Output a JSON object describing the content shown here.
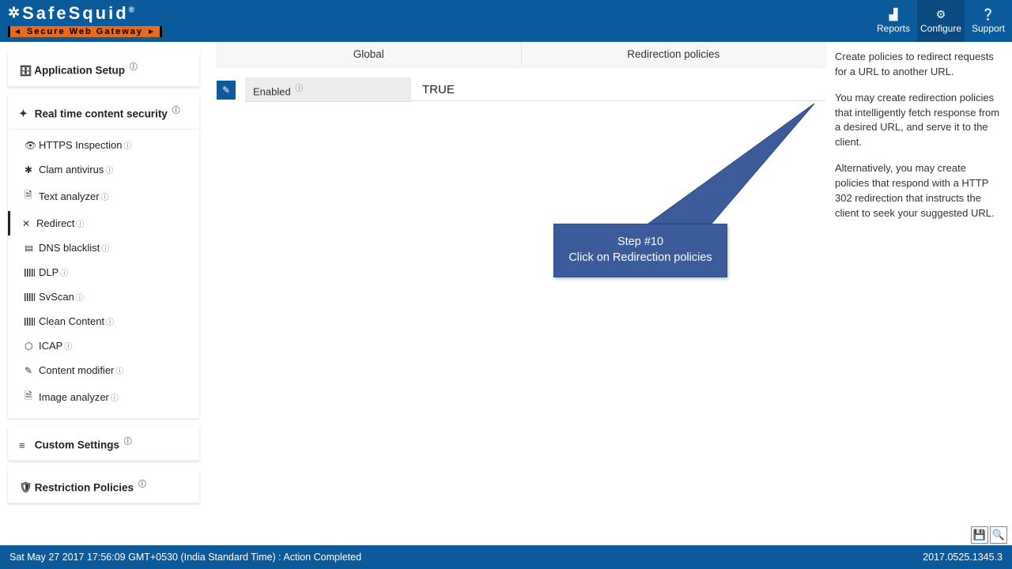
{
  "brand": {
    "name": "SafeSquid",
    "reg": "®",
    "tagline": "Secure Web Gateway"
  },
  "header_nav": {
    "reports": "Reports",
    "configure": "Configure",
    "support": "Support"
  },
  "sidebar": {
    "app_setup": "Application Setup",
    "rtcs": "Real time content security",
    "items": {
      "https": "HTTPS Inspection",
      "clam": "Clam antivirus",
      "text": "Text analyzer",
      "redirect": "Redirect",
      "dns": "DNS blacklist",
      "dlp": "DLP",
      "svscan": "SvScan",
      "clean": "Clean Content",
      "icap": "ICAP",
      "contentmod": "Content modifier",
      "image": "Image analyzer"
    },
    "custom": "Custom Settings",
    "restriction": "Restriction Policies"
  },
  "tabs": {
    "global": "Global",
    "redir": "Redirection policies"
  },
  "setting": {
    "label": "Enabled",
    "value": "TRUE"
  },
  "callout": {
    "line1": "Step #10",
    "line2": "Click on Redirection policies"
  },
  "help": {
    "p1": "Create policies to redirect requests for a URL to another URL.",
    "p2": "You may create redirection policies that intelligently fetch response from a desired URL, and serve it to the client.",
    "p3": "Alternatively, you may create policies that respond with a HTTP 302 redirection that instructs the client to seek your suggested URL."
  },
  "footer": {
    "status": "Sat May 27 2017 17:56:09 GMT+0530 (India Standard Time) : Action Completed",
    "version": "2017.0525.1345.3"
  }
}
